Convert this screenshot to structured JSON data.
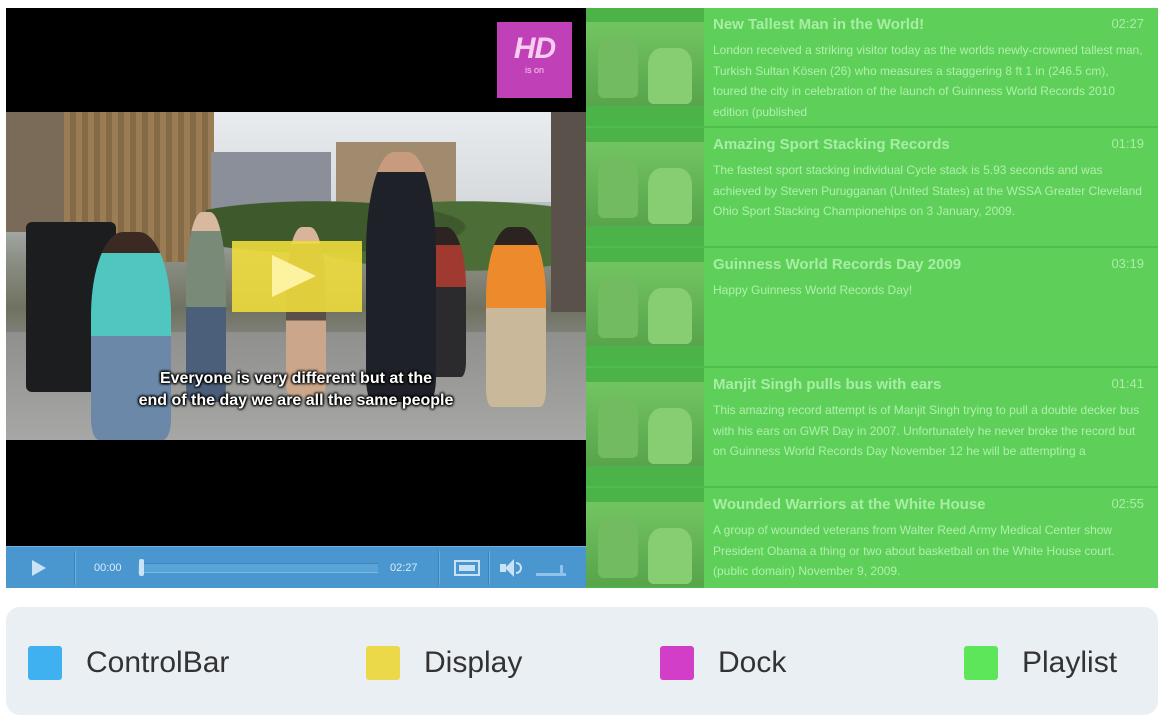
{
  "player": {
    "subtitle_line1": "Everyone is very different but at the",
    "subtitle_line2": "end of the day we are all the same people",
    "dock": {
      "hd_label": "HD",
      "hd_status": "is on"
    },
    "controlbar": {
      "elapsed": "00:00",
      "duration": "02:27",
      "progress": 0,
      "icons": [
        "play-icon",
        "fullscreen-icon",
        "volume-icon"
      ]
    }
  },
  "playlist": {
    "items": [
      {
        "title": "New Tallest Man in the World!",
        "duration": "02:27",
        "description": "London received a striking visitor today as the worlds newly-crowned tallest man, Turkish Sultan Kösen (26) who measures a staggering 8 ft 1 in (246.5 cm), toured the city in celebration of the launch of Guinness World Records 2010 edition (published"
      },
      {
        "title": "Amazing Sport Stacking Records",
        "duration": "01:19",
        "description": "The fastest sport stacking individual Cycle stack is 5.93 seconds and was achieved by Steven Purugganan (United States) at the WSSA Greater Cleveland Ohio Sport Stacking Championehips on 3 January, 2009."
      },
      {
        "title": "Guinness World Records Day 2009",
        "duration": "03:19",
        "description": "Happy Guinness World Records Day!"
      },
      {
        "title": "Manjit Singh pulls bus with ears",
        "duration": "01:41",
        "description": "This amazing record attempt is of Manjit Singh trying to pull a double decker bus with his ears on GWR Day in 2007. Unfortunately he never broke the record but on Guinness World Records Day November 12 he will be attempting a"
      },
      {
        "title": "Wounded Warriors at the White House",
        "duration": "02:55",
        "description": "A group of wounded veterans from Walter Reed Army Medical Center show President Obama a thing or two about basketball on the White House court. (public domain) November 9, 2009."
      }
    ]
  },
  "legend": {
    "items": [
      {
        "label": "ControlBar",
        "color": "#3fb0f0"
      },
      {
        "label": "Display",
        "color": "#ecd94a"
      },
      {
        "label": "Dock",
        "color": "#d23ec8"
      },
      {
        "label": "Playlist",
        "color": "#5ee65a"
      }
    ]
  },
  "colors": {
    "controlbar": "#4a97cf",
    "display": "#eedc3c",
    "dock": "#c040b8",
    "playlist": "#5ed05a"
  }
}
